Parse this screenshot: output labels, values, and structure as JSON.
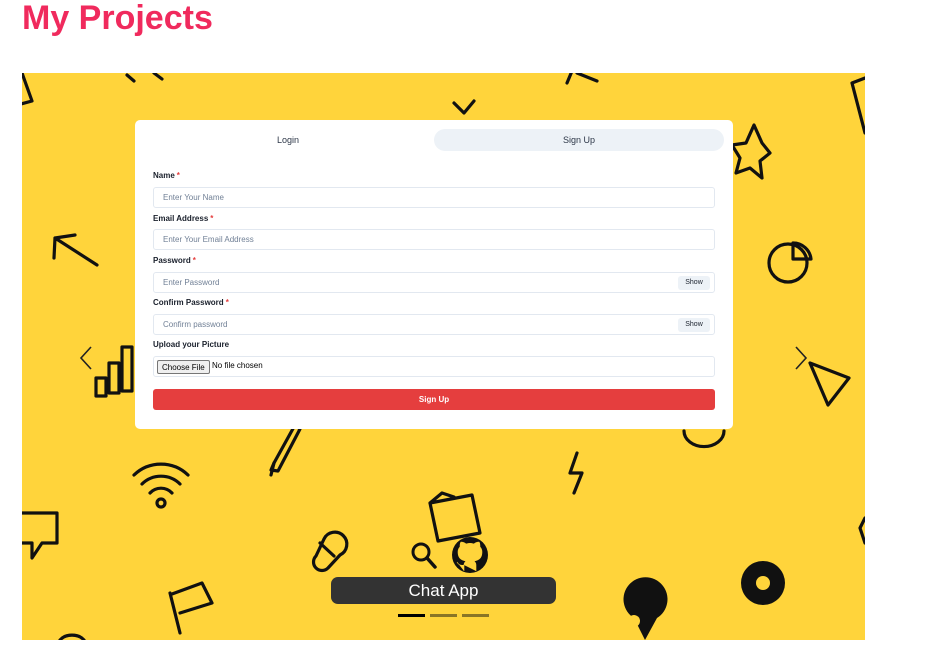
{
  "page": {
    "title": "My Projects",
    "title_color": "#f02a5d"
  },
  "carousel": {
    "background_color": "#ffd43b",
    "prev_icon": "chevron-left-icon",
    "next_icon": "chevron-right-icon",
    "slides_count": 3,
    "active_slide": 0,
    "caption": "Chat App",
    "project_icons": [
      "search-icon",
      "github-icon"
    ]
  },
  "signup_form": {
    "tabs": [
      "Login",
      "Sign Up"
    ],
    "active_tab": "Sign Up",
    "required_marker": "*",
    "fields": [
      {
        "label": "Name",
        "placeholder": "Enter Your Name"
      },
      {
        "label": "Email Address",
        "placeholder": "Enter Your Email Address"
      },
      {
        "label": "Password",
        "placeholder": "Enter Password",
        "toggle": "Show"
      },
      {
        "label": "Confirm Password",
        "placeholder": "Confirm password",
        "toggle": "Show"
      }
    ],
    "upload": {
      "label": "Upload your Picture",
      "button": "Choose File",
      "status": "No file chosen"
    },
    "submit": {
      "label": "Sign Up",
      "color": "#e53e3e"
    }
  }
}
